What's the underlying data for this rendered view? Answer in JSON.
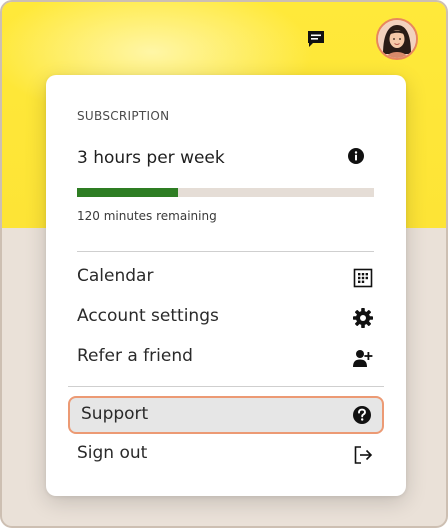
{
  "topbar": {
    "messages_icon": "chat-bubble-icon",
    "avatar": "user-avatar"
  },
  "subscription": {
    "section_label": "SUBSCRIPTION",
    "plan": "3 hours per week",
    "info_icon": "info-icon",
    "progress_fraction": 0.34,
    "remaining_text": "120 minutes remaining",
    "progress_color": "#2e7d23"
  },
  "menu": {
    "items": [
      {
        "label": "Calendar",
        "icon": "calendar-grid-icon"
      },
      {
        "label": "Account settings",
        "icon": "gear-icon"
      },
      {
        "label": "Refer a friend",
        "icon": "add-person-icon"
      },
      {
        "label": "Support",
        "icon": "help-icon"
      },
      {
        "label": "Sign out",
        "icon": "sign-out-icon"
      }
    ]
  },
  "colors": {
    "banner_yellow": "#ffe93a",
    "highlight_border": "#ec9a74",
    "highlight_bg": "#e6e6e6"
  }
}
